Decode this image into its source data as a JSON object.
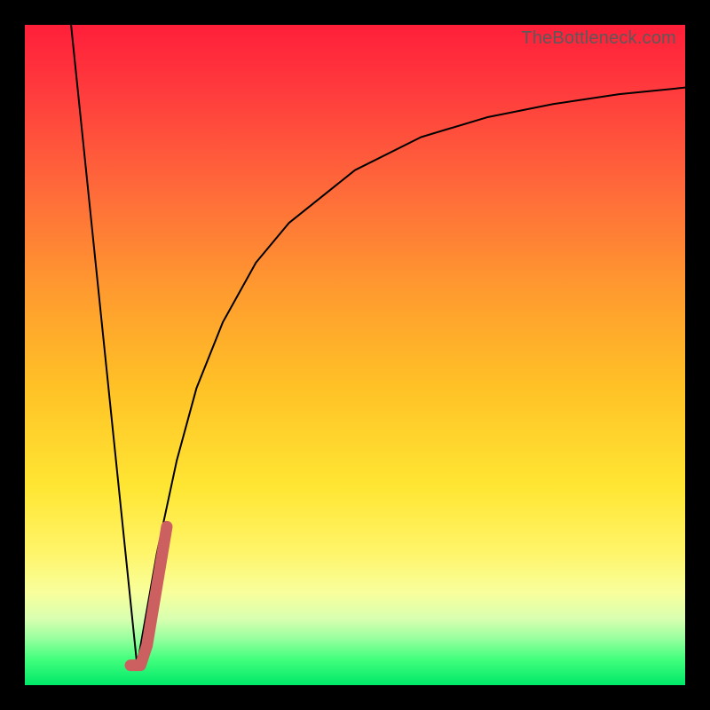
{
  "watermark": "TheBottleneck.com",
  "chart_data": {
    "type": "line",
    "title": "",
    "xlabel": "",
    "ylabel": "",
    "xlim": [
      0,
      100
    ],
    "ylim": [
      0,
      100
    ],
    "grid": false,
    "legend": false,
    "series": [
      {
        "name": "descending-left-line",
        "x": [
          7,
          17
        ],
        "y": [
          100,
          3
        ],
        "color": "#000000",
        "stroke_width": 2
      },
      {
        "name": "ascending-main-curve",
        "x": [
          17,
          20,
          23,
          26,
          30,
          35,
          40,
          50,
          60,
          70,
          80,
          90,
          100
        ],
        "y": [
          3,
          20,
          34,
          45,
          55,
          64,
          70,
          78,
          83,
          86,
          88,
          89.5,
          90.5
        ],
        "color": "#000000",
        "stroke_width": 2
      },
      {
        "name": "highlight-segment",
        "x": [
          16,
          17.5,
          18.5,
          19.5,
          20.5,
          21.5
        ],
        "y": [
          3,
          3,
          6,
          12,
          18,
          24
        ],
        "color": "#cc5f5f",
        "stroke_width": 13
      }
    ]
  }
}
